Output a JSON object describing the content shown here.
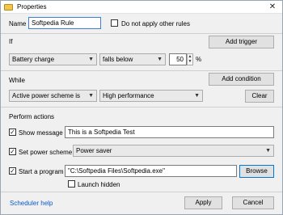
{
  "window": {
    "title": "Properties",
    "close_glyph": "✕"
  },
  "name_section": {
    "name_label": "Name",
    "name_value": "Softpedia Rule",
    "skip_other_label": "Do not apply other rules",
    "skip_other_checked": false
  },
  "if_section": {
    "heading": "If",
    "add_trigger_label": "Add trigger",
    "condition": "Battery charge",
    "operator": "falls below",
    "value": "50",
    "unit": "%"
  },
  "while_section": {
    "heading": "While",
    "add_condition_label": "Add condition",
    "condition": "Active power scheme is",
    "value": "High performance",
    "clear_label": "Clear"
  },
  "actions_section": {
    "heading": "Perform actions",
    "show_message_label": "Show message",
    "show_message_checked": true,
    "message_value": "This is a Softpedia Test",
    "set_scheme_label": "Set power scheme",
    "set_scheme_checked": true,
    "scheme_value": "Power saver",
    "start_program_label": "Start a program",
    "start_program_checked": true,
    "program_path": "\"C:\\Softpedia Files\\Softpedia.exe\"",
    "browse_label": "Browse",
    "launch_hidden_label": "Launch hidden",
    "launch_hidden_checked": false
  },
  "footer": {
    "help_link": "Scheduler help",
    "apply_label": "Apply",
    "cancel_label": "Cancel"
  },
  "colors": {
    "accent": "#0078d7",
    "link": "#0a58c8"
  }
}
